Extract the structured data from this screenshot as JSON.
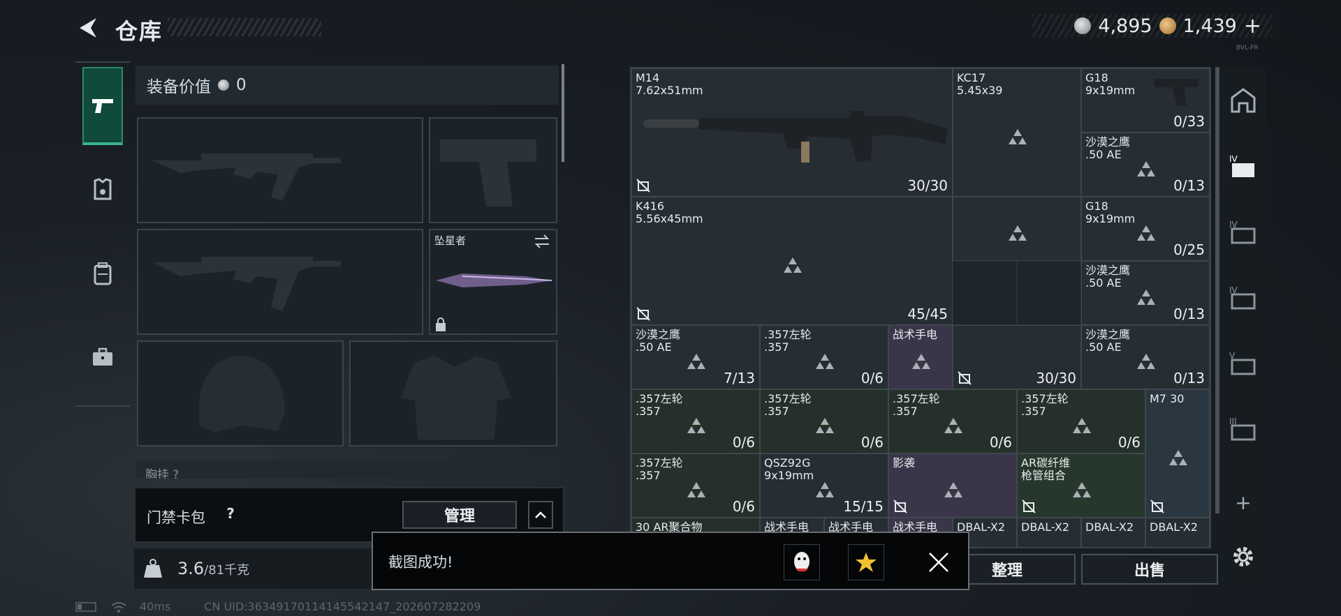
{
  "header": {
    "title": "仓库",
    "silver": "4,895",
    "gold": "1,439",
    "plus": "+",
    "tag": "BVL-FR"
  },
  "equip": {
    "value_label": "装备价值",
    "value": "0",
    "melee_name": "坠星者",
    "chest_label": "胸挂",
    "keycard_label": "门禁卡包",
    "manage": "管理",
    "weight": "3.6",
    "weight_max": "/81千克"
  },
  "grid_items": [
    {
      "name": "M14\n7.62x51mm",
      "count": "30/30"
    },
    {
      "name": "KC17\n5.45x39",
      "count": ""
    },
    {
      "name": "G18\n9x19mm",
      "count": "0/33"
    },
    {
      "name": "沙漠之鹰\n.50 AE",
      "count": "0/13"
    },
    {
      "name": "K416\n5.56x45mm",
      "count": "45/45"
    },
    {
      "name": "",
      "count": ""
    },
    {
      "name": "G18\n9x19mm",
      "count": "0/25"
    },
    {
      "name": "沙漠之鹰\n.50 AE",
      "count": "0/13"
    },
    {
      "name": "沙漠之鹰\n.50 AE",
      "count": "7/13"
    },
    {
      "name": ".357左轮\n.357",
      "count": "0/6"
    },
    {
      "name": "战术手电",
      "count": ""
    },
    {
      "name": "",
      "count": "30/30"
    },
    {
      "name": "沙漠之鹰\n.50 AE",
      "count": "0/13"
    },
    {
      "name": ".357左轮\n.357",
      "count": "0/6"
    },
    {
      "name": ".357左轮\n.357",
      "count": "0/6"
    },
    {
      "name": ".357左轮\n.357",
      "count": "0/6"
    },
    {
      "name": ".357左轮\n.357",
      "count": "0/6"
    },
    {
      "name": "M7 30",
      "count": ""
    },
    {
      "name": ".357左轮\n.357",
      "count": "0/6"
    },
    {
      "name": "QSZ92G\n9x19mm",
      "count": "15/15"
    },
    {
      "name": "影袭",
      "count": ""
    },
    {
      "name": "AR碳纤维\n枪管组合",
      "count": ""
    },
    {
      "name": "",
      "count": ""
    },
    {
      "name": "30 AR聚合物",
      "count": ""
    },
    {
      "name": "战术手电",
      "count": ""
    },
    {
      "name": "战术手电",
      "count": ""
    },
    {
      "name": "战术手电",
      "count": ""
    },
    {
      "name": "DBAL-X2",
      "count": ""
    },
    {
      "name": "DBAL-X2",
      "count": ""
    },
    {
      "name": "DBAL-X2",
      "count": ""
    },
    {
      "name": "DBAL-X2",
      "count": ""
    }
  ],
  "buttons": {
    "tidy": "整理",
    "sell": "出售"
  },
  "toast": {
    "text": "截图成功!"
  },
  "status": {
    "ping": "40ms",
    "uid": "CN UID:3634917011414554214​7_202607282209"
  }
}
